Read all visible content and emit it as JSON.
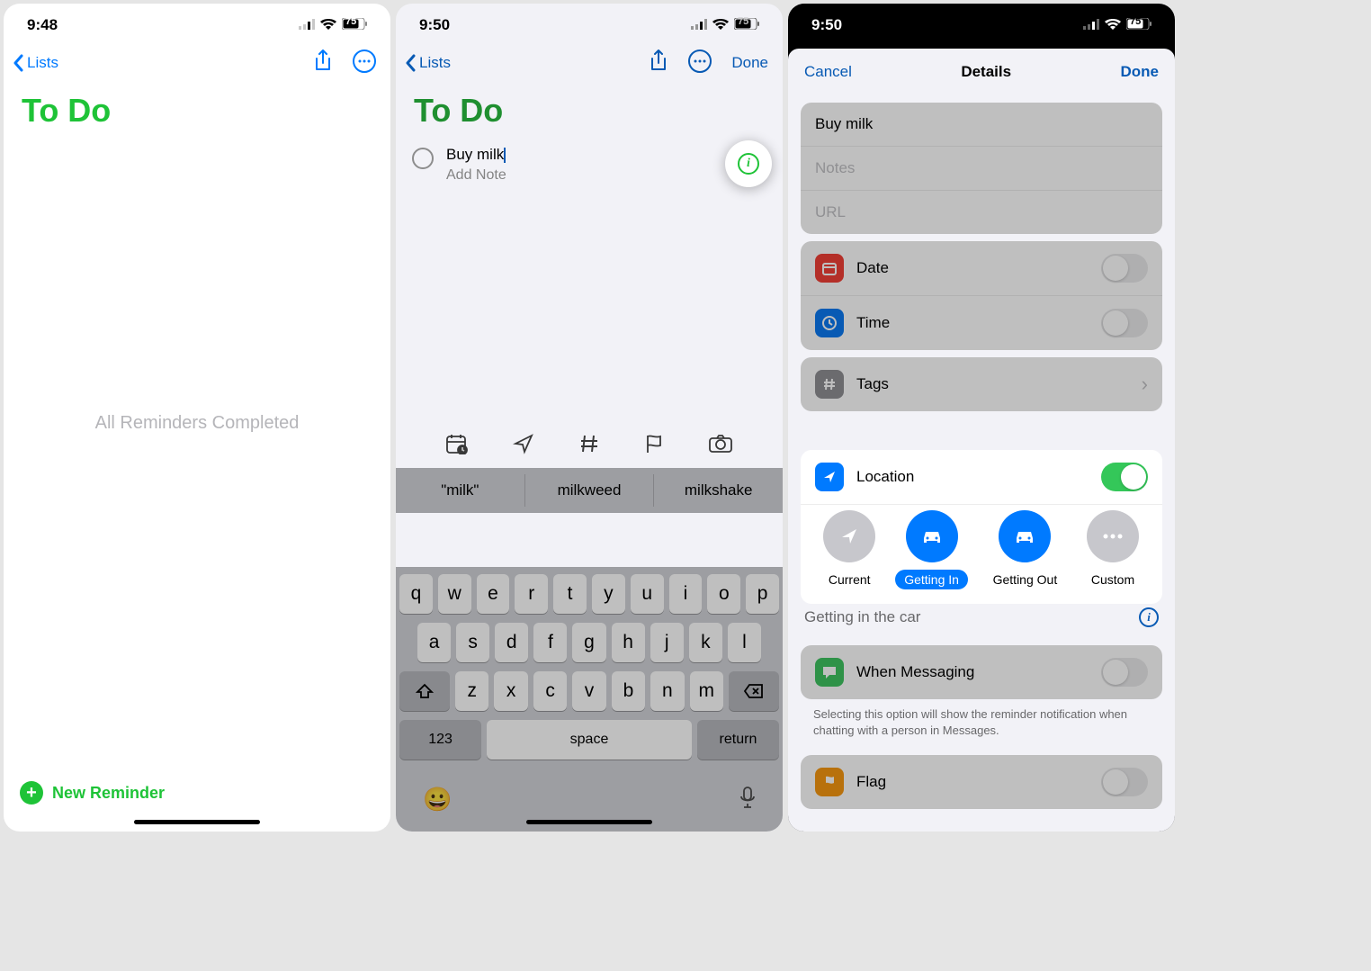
{
  "screen1": {
    "time": "9:48",
    "battery": "75",
    "back": "Lists",
    "title": "To Do",
    "empty": "All Reminders Completed",
    "newReminder": "New Reminder"
  },
  "screen2": {
    "time": "9:50",
    "battery": "75",
    "back": "Lists",
    "done": "Done",
    "title": "To Do",
    "reminder": "Buy milk",
    "notePlaceholder": "Add Note",
    "suggestions": [
      "\"milk\"",
      "milkweed",
      "milkshake"
    ],
    "keys": {
      "row1": [
        "q",
        "w",
        "e",
        "r",
        "t",
        "y",
        "u",
        "i",
        "o",
        "p"
      ],
      "row2": [
        "a",
        "s",
        "d",
        "f",
        "g",
        "h",
        "j",
        "k",
        "l"
      ],
      "row3": [
        "z",
        "x",
        "c",
        "v",
        "b",
        "n",
        "m"
      ],
      "num": "123",
      "space": "space",
      "ret": "return"
    }
  },
  "screen3": {
    "time": "9:50",
    "battery": "75",
    "cancel": "Cancel",
    "navTitle": "Details",
    "done": "Done",
    "reminder": "Buy milk",
    "notesPlaceholder": "Notes",
    "urlPlaceholder": "URL",
    "date": "Date",
    "timeRow": "Time",
    "tags": "Tags",
    "location": "Location",
    "locOptions": {
      "current": "Current",
      "gettingIn": "Getting In",
      "gettingOut": "Getting Out",
      "custom": "Custom"
    },
    "locStatus": "Getting in the car",
    "messaging": "When Messaging",
    "messagingHelper": "Selecting this option will show the reminder notification when chatting with a person in Messages.",
    "flag": "Flag"
  }
}
